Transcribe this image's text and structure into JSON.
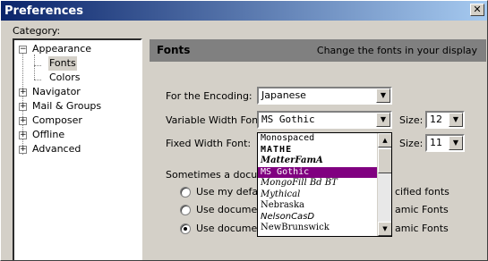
{
  "window": {
    "title": "Preferences",
    "close_glyph": "✕"
  },
  "category": {
    "label": "Category:"
  },
  "tree": {
    "items": [
      {
        "label": "Appearance",
        "expander": "−"
      },
      {
        "label": "Fonts"
      },
      {
        "label": "Colors"
      },
      {
        "label": "Navigator",
        "expander": "+"
      },
      {
        "label": "Mail & Groups",
        "expander": "+"
      },
      {
        "label": "Composer",
        "expander": "+"
      },
      {
        "label": "Offline",
        "expander": "+"
      },
      {
        "label": "Advanced",
        "expander": "+"
      }
    ]
  },
  "header": {
    "title": "Fonts",
    "subtitle": "Change the fonts in your display"
  },
  "encoding": {
    "label": "For the Encoding:",
    "value": "Japanese"
  },
  "variable_font": {
    "label": "Variable Width Font:",
    "value": "MS Gothic",
    "size_label": "Size:",
    "size_value": "12"
  },
  "fixed_font": {
    "label": "Fixed Width Font:",
    "size_label": "Size:",
    "size_value": "11"
  },
  "dropdown": {
    "items": [
      "Monospaced",
      "MATHE",
      "MatterFamA",
      "MS Gothic",
      "MongoFill Bd BT",
      "Mythical",
      "Nebraska",
      "NelsonCasD",
      "NewBrunswick"
    ],
    "selected_index": 3
  },
  "document_fonts": {
    "intro": "Sometimes a docume",
    "options": [
      {
        "label_visible": "Use my defaul",
        "trailing": "cified fonts",
        "selected": false
      },
      {
        "label_visible": "Use document",
        "trailing": "amic Fonts",
        "selected": false
      },
      {
        "label_visible": "Use document",
        "trailing": "amic Fonts",
        "selected": true
      }
    ]
  },
  "icons": {
    "dropdown_arrow": "▼",
    "scroll_up": "▲",
    "scroll_down": "▼"
  }
}
